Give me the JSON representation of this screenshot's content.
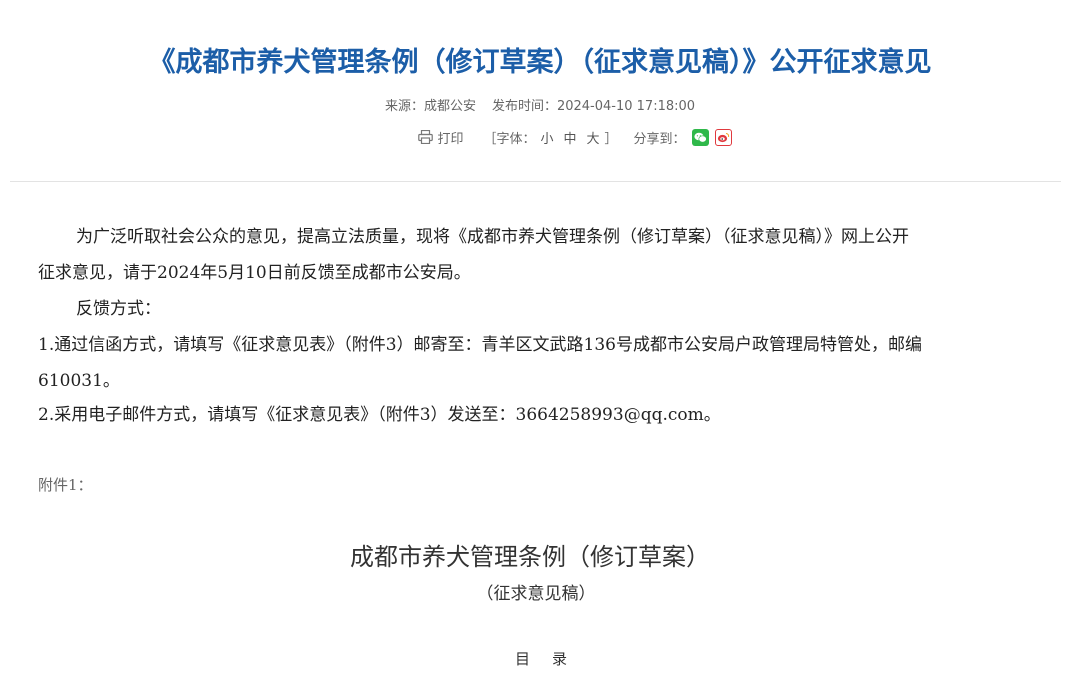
{
  "article": {
    "title": "《成都市养犬管理条例（修订草案）（征求意见稿）》公开征求意见",
    "source_label": "来源：成都公安",
    "publish_label": "发布时间：2024-04-10 17:18:00"
  },
  "tools": {
    "print_label": "打印",
    "font_open": "［字体：",
    "font_small": "小",
    "font_medium": "中",
    "font_large": "大",
    "font_close": "］",
    "share_label": "分享到：",
    "wechat_icon": "wechat-icon",
    "weibo_icon": "weibo-icon"
  },
  "content": {
    "para1_line1": "为广泛听取社会公众的意见，提高立法质量，现将《成都市养犬管理条例（修订草案）（征求意见稿）》网上公开",
    "para1_line2": "征求意见，请于2024年5月10日前反馈至成都市公安局。",
    "para2": "反馈方式：",
    "para3_line1": "1.通过信函方式，请填写《征求意见表》（附件3）邮寄至：青羊区文武路136号成都市公安局户政管理局特管处，邮编",
    "para3_line2": "610031。",
    "para4": "2.采用电子邮件方式，请填写《征求意见表》（附件3）发送至：3664258993@qq.com。"
  },
  "attachment": {
    "label": "附件1：",
    "doc_title": "成都市养犬管理条例（修订草案）",
    "doc_subtitle": "（征求意见稿）",
    "toc_label": "目录"
  },
  "colors": {
    "title": "#1c5ea8",
    "wechat": "#2fb84a",
    "weibo": "#e0393e"
  }
}
